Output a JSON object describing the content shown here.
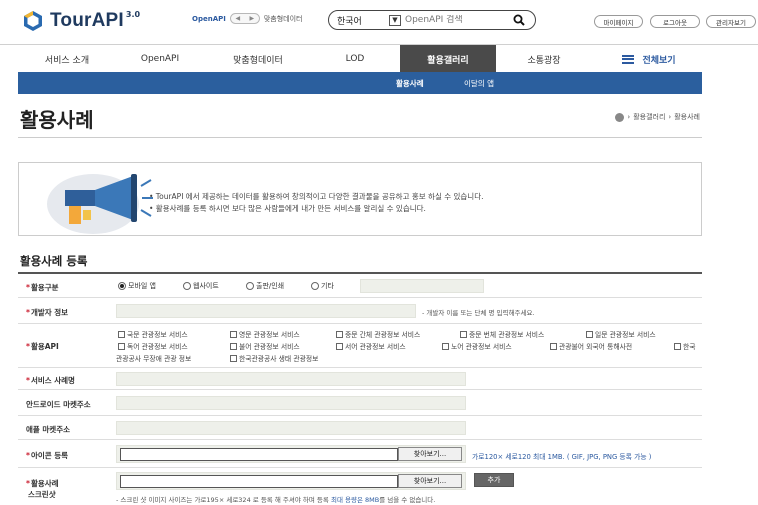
{
  "header": {
    "logo_text": "TourAPI",
    "logo_version": "3.0",
    "switcher_label": "OpenAPI",
    "switcher_label2": "맞춤형데이터",
    "search_lang": "한국어",
    "search_placeholder": "OpenAPI 검색",
    "util_links": [
      "마이페이지",
      "로그아웃",
      "관리자보기"
    ]
  },
  "gnb": {
    "items": [
      "서비스 소개",
      "OpenAPI",
      "맞춤형데이터",
      "LOD",
      "활용갤러리",
      "소통광장"
    ],
    "active_index": 4,
    "all_label": "전체보기"
  },
  "subnav": {
    "items": [
      "활용사례",
      "이달의 앱"
    ],
    "active_index": 0
  },
  "page": {
    "title": "활용사례",
    "breadcrumb": [
      "활용갤러리",
      "활용사례"
    ]
  },
  "intro": {
    "lines": [
      "•  TourAPI 에서 제공하는 데이터를 활용하여 창의적이고 다양한 결과물을 공유하고 홍보 하실 수 있습니다.",
      "•  활용사례를 등록 하시면 보다 많은 사람들에게 내가 만든 서비스를 알리실 수 있습니다."
    ]
  },
  "form": {
    "section_title": "활용사례 등록",
    "labels": {
      "type": "활용구분",
      "developer": "개발자 정보",
      "api": "활용API",
      "service_name": "서비스 사례명",
      "android": "안드로이드 마켓주소",
      "apple": "애플 마켓주소",
      "icon": "아이콘 등록",
      "screenshot_1": "활용사례",
      "screenshot_2": "스크린샷"
    },
    "type_options": [
      "모바일 앱",
      "웹사이트",
      "출판/인쇄",
      "기타"
    ],
    "type_selected": 0,
    "developer_hint": "- 개발자 이름 또는 단체 명 입력해주세요.",
    "api_options": [
      "국문 관광정보 서비스",
      "영문 관광정보 서비스",
      "중문 간체 관광정보 서비스",
      "중문 번체 관광정보 서비스",
      "일문 관광정보 서비스",
      "독어 관광정보 서비스",
      "불어 관광정보 서비스",
      "서어 관광정보 서비스",
      "노어 관광정보 서비스",
      "관광불어 외국어 통해사전",
      "한국",
      "관광공사 무장애 관광 정보",
      "한국관광공사 생태 관광정보"
    ],
    "browse_label": "찾아보기...",
    "icon_hint": "가로120× 세로120 최대 1MB. ( GIF, JPG, PNG 등록 가능 )",
    "add_label": "추가",
    "screenshot_hint_a": "- 스크린 샷 이미지 사이즈는 가로195× 세로324 로 등록 해 주셔야 하며 등록",
    "screenshot_hint_b": "최대 용량은 8MB",
    "screenshot_hint_c": "를 넘을 수 없습니다."
  },
  "colors": {
    "brand": "#1f3a5f",
    "subnav": "#2b5f9e",
    "active_tab": "#4a4a4a",
    "field": "#eef0ea"
  }
}
